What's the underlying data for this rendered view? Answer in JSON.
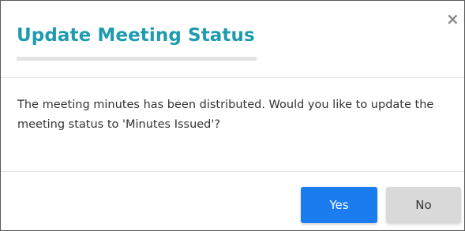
{
  "dialog": {
    "title": "Update Meeting Status",
    "close_glyph": "×",
    "close_icon": "close-icon",
    "message": "The meeting minutes has been distributed. Would you like to update the meeting status to 'Minutes Issued'?",
    "buttons": {
      "yes_label": "Yes",
      "no_label": "No"
    },
    "colors": {
      "title": "#1f9bb0",
      "primary": "#1a7cef",
      "secondary": "#d9d9d9"
    }
  }
}
